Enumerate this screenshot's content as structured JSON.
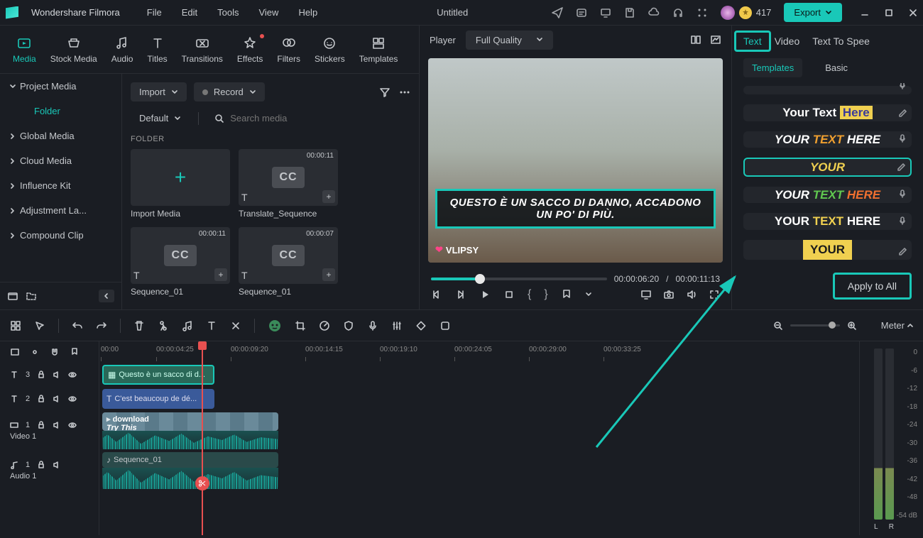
{
  "app_name": "Wondershare Filmora",
  "menus": [
    "File",
    "Edit",
    "Tools",
    "View",
    "Help"
  ],
  "document_title": "Untitled",
  "coins": "417",
  "export_label": "Export",
  "library_tabs": [
    {
      "id": "media",
      "label": "Media"
    },
    {
      "id": "stock",
      "label": "Stock Media"
    },
    {
      "id": "audio",
      "label": "Audio"
    },
    {
      "id": "titles",
      "label": "Titles"
    },
    {
      "id": "transitions",
      "label": "Transitions"
    },
    {
      "id": "effects",
      "label": "Effects"
    },
    {
      "id": "filters",
      "label": "Filters"
    },
    {
      "id": "stickers",
      "label": "Stickers"
    },
    {
      "id": "templates",
      "label": "Templates"
    }
  ],
  "sidebar": {
    "project_media": "Project Media",
    "folder": "Folder",
    "items": [
      "Global Media",
      "Cloud Media",
      "Influence Kit",
      "Adjustment La...",
      "Compound Clip"
    ]
  },
  "media_toolbar": {
    "import": "Import",
    "record": "Record",
    "default": "Default",
    "search_placeholder": "Search media",
    "folder_heading": "FOLDER"
  },
  "media_items": [
    {
      "label": "Import Media",
      "type": "import"
    },
    {
      "label": "Translate_Sequence",
      "dur": "00:00:11",
      "type": "cc"
    },
    {
      "label": "Sequence_01",
      "dur": "00:00:11",
      "type": "cc"
    },
    {
      "label": "Sequence_01",
      "dur": "00:00:07",
      "type": "cc"
    }
  ],
  "preview": {
    "player_label": "Player",
    "quality": "Full Quality",
    "subtitle": "QUESTO È UN SACCO DI DANNO, ACCADONO UN PO' DI PIÙ.",
    "watermark": "VLIPSY",
    "current_time": "00:00:06:20",
    "sep": "/",
    "duration": "00:00:11:13"
  },
  "inspector": {
    "tabs": [
      "Text",
      "Video",
      "Text To Spee"
    ],
    "subtabs": [
      "Templates",
      "Basic"
    ],
    "apply_all": "Apply to All"
  },
  "timeline": {
    "meter_label": "Meter",
    "ruler": [
      "00:00",
      "00:00:04:25",
      "00:00:09:20",
      "00:00:14:15",
      "00:00:19:10",
      "00:00:24:05",
      "00:00:29:00",
      "00:00:33:25"
    ],
    "tracks": {
      "t3": {
        "num": "3",
        "clip": "Questo è un sacco di d..."
      },
      "t2": {
        "num": "2",
        "clip": "C'est beaucoup de dé..."
      },
      "v1": {
        "num": "1",
        "label": "Video 1",
        "clip": "download",
        "overlay": "Try This"
      },
      "a1": {
        "num": "1",
        "label": "Audio 1",
        "clip": "Sequence_01"
      }
    },
    "meter_ticks": [
      "0",
      "-6",
      "-12",
      "-18",
      "-24",
      "-30",
      "-36",
      "-42",
      "-48",
      "-54"
    ],
    "meter_unit": "dB",
    "meter_lr": [
      "L",
      "R"
    ]
  }
}
